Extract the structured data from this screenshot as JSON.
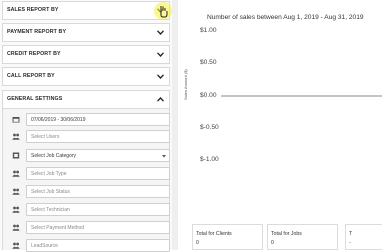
{
  "sidebar": {
    "sections": [
      {
        "label": "SALES REPORT BY",
        "state": "collapsed"
      },
      {
        "label": "PAYMENT REPORT BY",
        "state": "collapsed"
      },
      {
        "label": "CREDIT REPORT BY",
        "state": "collapsed"
      },
      {
        "label": "CALL REPORT BY",
        "state": "collapsed"
      },
      {
        "label": "GENERAL SETTINGS",
        "state": "expanded"
      }
    ],
    "general_settings": {
      "date_range": "07/06/2019 - 30/06/2019",
      "users_placeholder": "Select Users",
      "job_category_value": "Select Job Category",
      "job_type_placeholder": "Select Job Type",
      "job_status_placeholder": "Select Job Status",
      "technician_placeholder": "Select Technician",
      "payment_method_placeholder": "Select Payment Method",
      "lead_source_placeholder": "LeadSource"
    }
  },
  "chart_data": {
    "type": "line",
    "title": "Number of sales between Aug 1, 2019 - Aug 31, 2019",
    "ylabel": "Sales Amount ($)",
    "yticks": [
      "$1.00",
      "$0.50",
      "$0.00",
      "$-0.50",
      "$-1.00"
    ],
    "ylim": [
      -1.0,
      1.0
    ],
    "series": [
      {
        "values": [
          0,
          0
        ]
      }
    ]
  },
  "summary": [
    {
      "label": "Total for Clients",
      "value": "0"
    },
    {
      "label": "Total for Jobs",
      "value": "0"
    },
    {
      "label": "T",
      "value": "-"
    }
  ],
  "colors": {
    "cursor_highlight": "#f6ef3a",
    "zero_line": "#888888"
  }
}
